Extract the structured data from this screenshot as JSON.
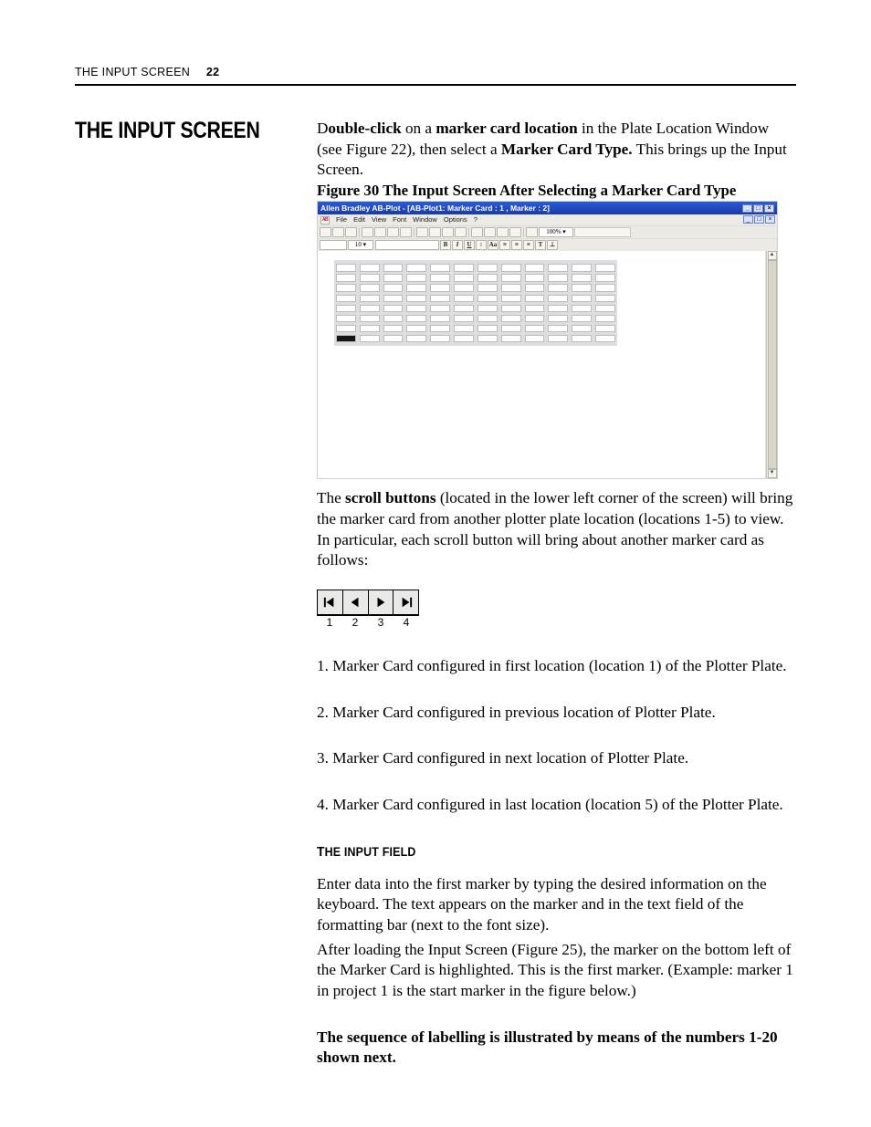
{
  "header": {
    "running": "THE INPUT SCREEN",
    "page": "22"
  },
  "side_heading": "THE INPUT SCREEN",
  "intro": {
    "lead_char": "D",
    "bold1": "ouble-click",
    "t1": " on a ",
    "bold2": "marker card location",
    "t2": " in the Plate Location Window (see Figure 22), then select a ",
    "bold3": "Marker Card Type.",
    "t3": " This brings up the Input Screen."
  },
  "fig_caption": "Figure 30 The Input Screen After Selecting a Marker Card Type",
  "screenshot": {
    "title": "Allen Bradley AB-Plot - [AB-Plot1: Marker Card : 1 , Marker : 2]",
    "win_buttons": [
      "_",
      "□",
      "×"
    ],
    "child_buttons": [
      "_",
      "□",
      "×"
    ],
    "menus": [
      "File",
      "Edit",
      "View",
      "Font",
      "Window",
      "Options",
      "?"
    ],
    "logo": "AB",
    "zoom": "100% ▾",
    "fontsize": "10  ▾",
    "fmt_buttons": [
      "B",
      "I",
      "U",
      "↕",
      "Aa",
      "≡",
      "≡",
      "≡",
      "T",
      "⊥"
    ]
  },
  "scroll_para": {
    "t1": "The ",
    "bold": "scroll buttons",
    "t2": " (located in the lower left corner of the screen) will bring the marker card from another plotter plate location (locations 1-5) to view. In particular, each scroll button will bring about another marker card as follows:"
  },
  "scroll_labels": [
    "1",
    "2",
    "3",
    "4"
  ],
  "list": {
    "i1": "1. Marker Card configured in first location (location 1) of the Plotter Plate.",
    "i2": "2. Marker Card configured in previous location of Plotter Plate.",
    "i3": "3. Marker Card configured in next location of Plotter Plate.",
    "i4": "4. Marker Card configured in last location (location 5) of the Plotter Plate."
  },
  "subhead": {
    "lead": "T",
    "rest": "HE INPUT FIELD"
  },
  "input_field": {
    "p1": "Enter data into the first marker by typing the desired information on the keyboard. The text appears on the marker and in the text field of the formatting bar (next to the font size).",
    "p2": "After loading the Input Screen (Figure 25), the marker on the bottom left of the Marker Card is highlighted. This is the first marker. (Example: marker 1 in project 1 is the start marker in the figure below.)"
  },
  "closing_bold": "The sequence of labelling is illustrated by means of the numbers 1-20 shown next."
}
